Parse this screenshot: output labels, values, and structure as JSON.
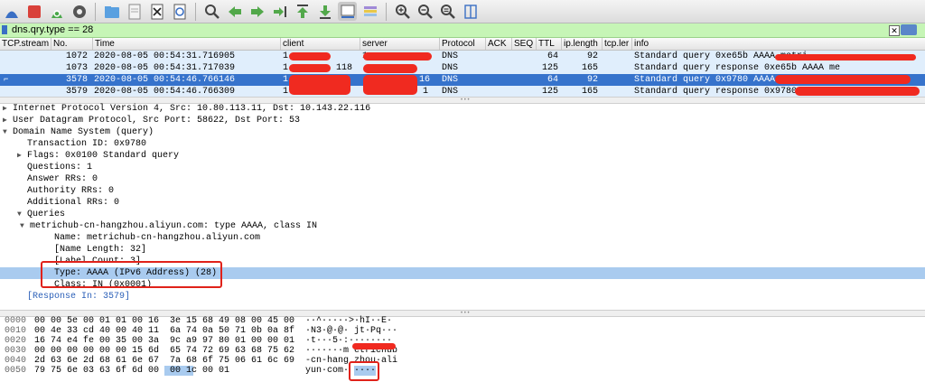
{
  "toolbar": {
    "icons": [
      "shark-fin-start-icon",
      "stop-capture-icon",
      "restart-capture-icon",
      "capture-options-icon",
      "open-file-icon",
      "save-file-icon",
      "close-file-icon",
      "reload-file-icon",
      "find-packet-icon",
      "go-back-icon",
      "go-forward-icon",
      "go-to-packet-icon",
      "go-first-icon",
      "go-last-icon",
      "autoscroll-icon",
      "colorize-icon",
      "zoom-in-icon",
      "zoom-out-icon",
      "zoom-normal-icon",
      "resize-columns-icon"
    ]
  },
  "filter": {
    "value": "dns.qry.type == 28"
  },
  "columns": [
    "TCP.stream",
    "No.",
    "Time",
    "client",
    "server",
    "Protocol",
    "ACK",
    "SEQ",
    "TTL",
    "ip.length",
    "tcp.ler",
    "info"
  ],
  "packets": [
    {
      "no": "1072",
      "time": "2020-08-05 00:54:31.716905",
      "client": "1",
      "server": "1",
      "protocol": "DNS",
      "ttl": "64",
      "length": "92",
      "info": "Standard query 0xe65b AAAA metri",
      "selected": false
    },
    {
      "no": "1073",
      "time": "2020-08-05 00:54:31.717039",
      "client": "1",
      "server": "118",
      "protocol": "DNS",
      "ttl": "125",
      "length": "165",
      "info": "Standard query response 0xe65b AAAA me",
      "selected": false
    },
    {
      "no": "3578",
      "time": "2020-08-05 00:54:46.766146",
      "client": "1",
      "server": "16",
      "protocol": "DNS",
      "ttl": "64",
      "length": "92",
      "info": "Standard query 0x9780 AAAA me",
      "selected": true
    },
    {
      "no": "3579",
      "time": "2020-08-05 00:54:46.766309",
      "client": "1",
      "server": "1",
      "protocol": "DNS",
      "ttl": "125",
      "length": "165",
      "info": "Standard query response 0x9780 AAAA m",
      "selected": false
    }
  ],
  "tree": [
    {
      "text": "Internet Protocol Version 4, Src: 10.80.113.11, Dst: 10.143.22.116",
      "indent": 0,
      "arrow": "right"
    },
    {
      "text": "User Datagram Protocol, Src Port: 58622, Dst Port: 53",
      "indent": 0,
      "arrow": "right"
    },
    {
      "text": "Domain Name System (query)",
      "indent": 0,
      "arrow": "down"
    },
    {
      "text": "Transaction ID: 0x9780",
      "indent": 1,
      "arrow": ""
    },
    {
      "text": "Flags: 0x0100 Standard query",
      "indent": 1,
      "arrow": "right"
    },
    {
      "text": "Questions: 1",
      "indent": 1,
      "arrow": ""
    },
    {
      "text": "Answer RRs: 0",
      "indent": 1,
      "arrow": ""
    },
    {
      "text": "Authority RRs: 0",
      "indent": 1,
      "arrow": ""
    },
    {
      "text": "Additional RRs: 0",
      "indent": 1,
      "arrow": ""
    },
    {
      "text": "Queries",
      "indent": 1,
      "arrow": "down"
    },
    {
      "text": "metrichub-cn-hangzhou.aliyun.com: type AAAA, class IN",
      "indent": 2,
      "arrow": "down"
    },
    {
      "text": "Name: metrichub-cn-hangzhou.aliyun.com",
      "indent": 3,
      "arrow": ""
    },
    {
      "text": "[Name Length: 32]",
      "indent": 3,
      "arrow": ""
    },
    {
      "text": "[Label Count: 3]",
      "indent": 3,
      "arrow": ""
    },
    {
      "text": "Type: AAAA (IPv6 Address) (28)",
      "indent": 3,
      "arrow": "",
      "highlight": true
    },
    {
      "text": "Class: IN (0x0001)",
      "indent": 3,
      "arrow": ""
    },
    {
      "text": "[Response In: 3579]",
      "indent": 1,
      "arrow": "",
      "link": true
    }
  ],
  "hex": [
    {
      "off": "0000",
      "hex": "00 00 5e 00 01 01 00 16  3e 15 68 49 08 00 45 00",
      "ascii": "··^·····>·hI··E·"
    },
    {
      "off": "0010",
      "hex": "00 4e 33 cd 40 00 40 11  6a 74 0a 50 71 0b 0a 8f",
      "ascii": "·N3·@·@· jt·Pq···"
    },
    {
      "off": "0020",
      "hex": "16 74 e4 fe 00 35 00 3a  9c a9 97 80 01 00 00 01",
      "ascii": "·t···5·:········"
    },
    {
      "off": "0030",
      "hex": "00 00 00 00 00 00 15 6d  65 74 72 69 63 68 75 62",
      "ascii": "·······m etrichub"
    },
    {
      "off": "0040",
      "hex": "2d 63 6e 2d 68 61 6e 67  7a 68 6f 75 06 61 6c 69",
      "ascii": "-cn-hang zhou·ali"
    },
    {
      "off": "0050",
      "hex": "79 75 6e 03 63 6f 6d 00  00 1c 00 01",
      "ascii": "yun·com· ····"
    }
  ],
  "colors": {
    "selected": "#3673cc",
    "dns_row": "#e0eefc",
    "filter_ok": "#c6f5b6",
    "annotation": "#e0221a"
  }
}
